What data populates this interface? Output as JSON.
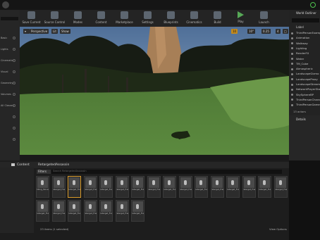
{
  "toolbar": {
    "buttons": [
      {
        "label": "Save Current",
        "icon": "save-icon"
      },
      {
        "label": "Source Control",
        "icon": "source-control-icon"
      },
      {
        "label": "Modes",
        "icon": "modes-icon"
      },
      {
        "label": "Content",
        "icon": "content-icon"
      },
      {
        "label": "Marketplace",
        "icon": "marketplace-icon"
      },
      {
        "label": "Settings",
        "icon": "settings-icon"
      },
      {
        "label": "Blueprints",
        "icon": "blueprints-icon"
      },
      {
        "label": "Cinematics",
        "icon": "cinematics-icon"
      },
      {
        "label": "Build",
        "icon": "build-icon"
      },
      {
        "label": "Play",
        "icon": "play-icon"
      },
      {
        "label": "Launch",
        "icon": "launch-icon"
      }
    ]
  },
  "viewport": {
    "perspective": "Perspective",
    "lit": "Lit",
    "show": "Show",
    "grid_snap": "10",
    "rot_snap": "10°",
    "scale_snap": "0.25",
    "cam_speed": "4"
  },
  "outliner": {
    "title": "World Outliner",
    "search_placeholder": "Search...",
    "label_header": "Label",
    "rows": [
      "ThirdPersonExampleMap",
      "Animation",
      "Walkway",
      "Lighting",
      "RenderFX",
      "Water",
      "TM_Cube",
      "Atmospheric",
      "LandscapeGizmo",
      "LandscapeProxy",
      "LandscapeStreaming",
      "NetworkPlayerStart",
      "SkySphereBP",
      "ThirdPersonCharacter",
      "ThirdPersonGameMode"
    ],
    "count": "13 actors",
    "view_options": "View Options"
  },
  "details": {
    "title": "Details"
  },
  "content_browser": {
    "path_root": "Content",
    "path_folder": "RetargetedAssassin",
    "filters": "Filters",
    "search_placeholder": "Search RetargetedAssassin",
    "status": "23 items (1 selected)",
    "view_options": "View Options",
    "assets": [
      "Idling_Movement",
      "retarget_Frank_RPG_Ambient",
      "retarget_Frank_RPG_Ambient",
      "retarget_Frank_RPG_Ambient",
      "retarget_Frank_RPG_Ambient",
      "retarget_Frank_RPG_Ambient",
      "retarget_Frank_RPG_Ambient",
      "retarget_Frank_RPG_Ambient",
      "retarget_Frank_RPG_Ambient",
      "retarget_Frank_RPG_Ambient",
      "retarget_Frank_RPG_Ambient",
      "retarget_Frank_RPG_Ambient",
      "retarget_Frank_RPG_Ambient",
      "retarget_Frank_RPG_Ambient",
      "retarget_Frank_RPG_Ambient",
      "retarget_Frank_RPG_Ambient",
      "retarget_Frank_RPG_Assassin",
      "retarget_Frank_RPG_Assassin",
      "retarget_Frank_RPG_Assassin",
      "retarget_Frank_RPG_Assassin",
      "retarget_Frank_RPG_Assassin",
      "retarget_Frank_RPG_Dual_Ability",
      "retarget_Frank_RPG_Rotation_Walk"
    ]
  }
}
